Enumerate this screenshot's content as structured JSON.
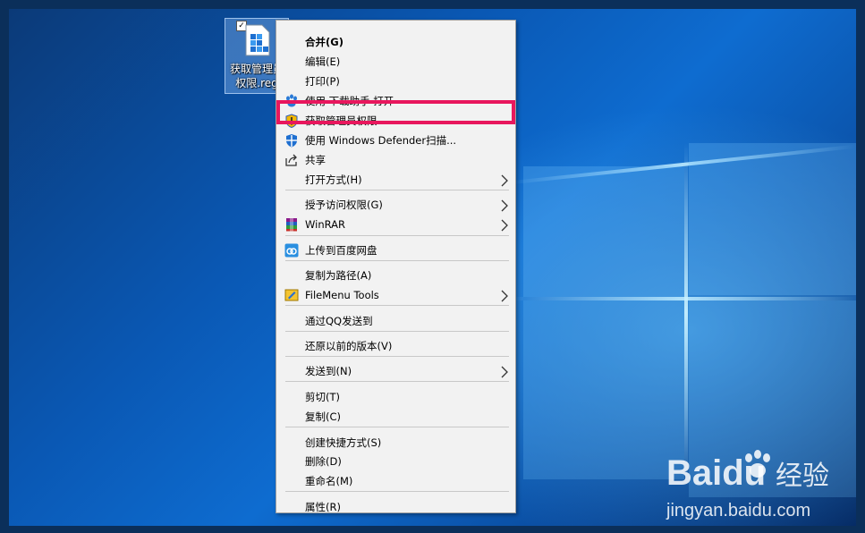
{
  "desktop": {
    "icon": {
      "label": "获取管理员权限.reg"
    }
  },
  "menu": {
    "items": [
      {
        "label": "合并(G)",
        "bold": true
      },
      {
        "label": "编辑(E)"
      },
      {
        "label": "打印(P)"
      },
      {
        "label": "使用 下载助手 打开",
        "icon": "paw-icon"
      },
      {
        "label": "获取管理员权限",
        "icon": "shield-icon"
      },
      {
        "label": "使用 Windows Defender扫描...",
        "icon": "defender-icon"
      },
      {
        "label": "共享",
        "icon": "share-icon"
      },
      {
        "label": "打开方式(H)",
        "submenu": true
      },
      {
        "label": "授予访问权限(G)",
        "submenu": true
      },
      {
        "label": "WinRAR",
        "icon": "winrar-icon",
        "submenu": true
      },
      {
        "label": "上传到百度网盘",
        "icon": "baidu-cloud-icon"
      },
      {
        "label": "复制为路径(A)"
      },
      {
        "label": "FileMenu Tools",
        "icon": "filemenu-icon",
        "submenu": true
      },
      {
        "label": "通过QQ发送到"
      },
      {
        "label": "还原以前的版本(V)"
      },
      {
        "label": "发送到(N)",
        "submenu": true
      },
      {
        "label": "剪切(T)"
      },
      {
        "label": "复制(C)"
      },
      {
        "label": "创建快捷方式(S)"
      },
      {
        "label": "删除(D)"
      },
      {
        "label": "重命名(M)"
      },
      {
        "label": "属性(R)"
      }
    ]
  },
  "watermark": {
    "brand": "Baidu",
    "product": "经验",
    "url": "jingyan.baidu.com"
  },
  "colors": {
    "highlight": "#e8175d",
    "menu_bg": "#f2f2f2"
  }
}
